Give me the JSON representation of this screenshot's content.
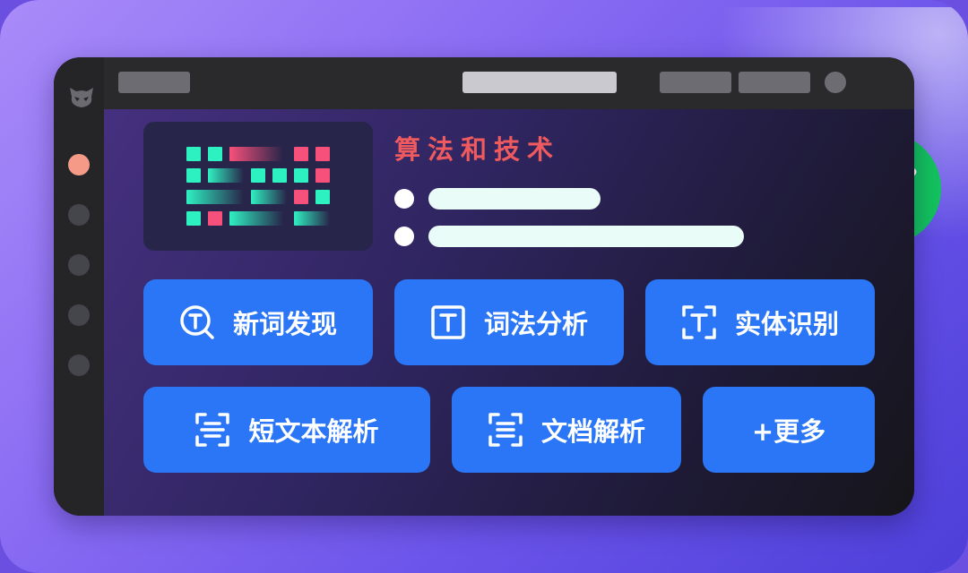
{
  "colors": {
    "accent": "#2a76f6",
    "title": "#ef5a5e",
    "success": "#13c25e",
    "active_dot": "#f59a86",
    "grid_green": "#2ef1c2",
    "grid_pink": "#f7507a"
  },
  "sidebar": {
    "logo_icon": "owl-logo-icon",
    "items": [
      {
        "active": true
      },
      {
        "active": false
      },
      {
        "active": false
      },
      {
        "active": false
      },
      {
        "active": false
      }
    ]
  },
  "section": {
    "title": "算法和技术",
    "image_icon": "pixel-grid-icon",
    "status_icon": "check-icon"
  },
  "features": {
    "row1": [
      {
        "label": "新词发现",
        "icon": "search-t-icon"
      },
      {
        "label": "词法分析",
        "icon": "text-box-icon"
      },
      {
        "label": "实体识别",
        "icon": "text-scan-icon"
      }
    ],
    "row2": [
      {
        "label": "短文本解析",
        "icon": "short-text-scan-icon"
      },
      {
        "label": "文档解析",
        "icon": "document-scan-icon"
      },
      {
        "label": "+更多",
        "icon": ""
      }
    ]
  }
}
